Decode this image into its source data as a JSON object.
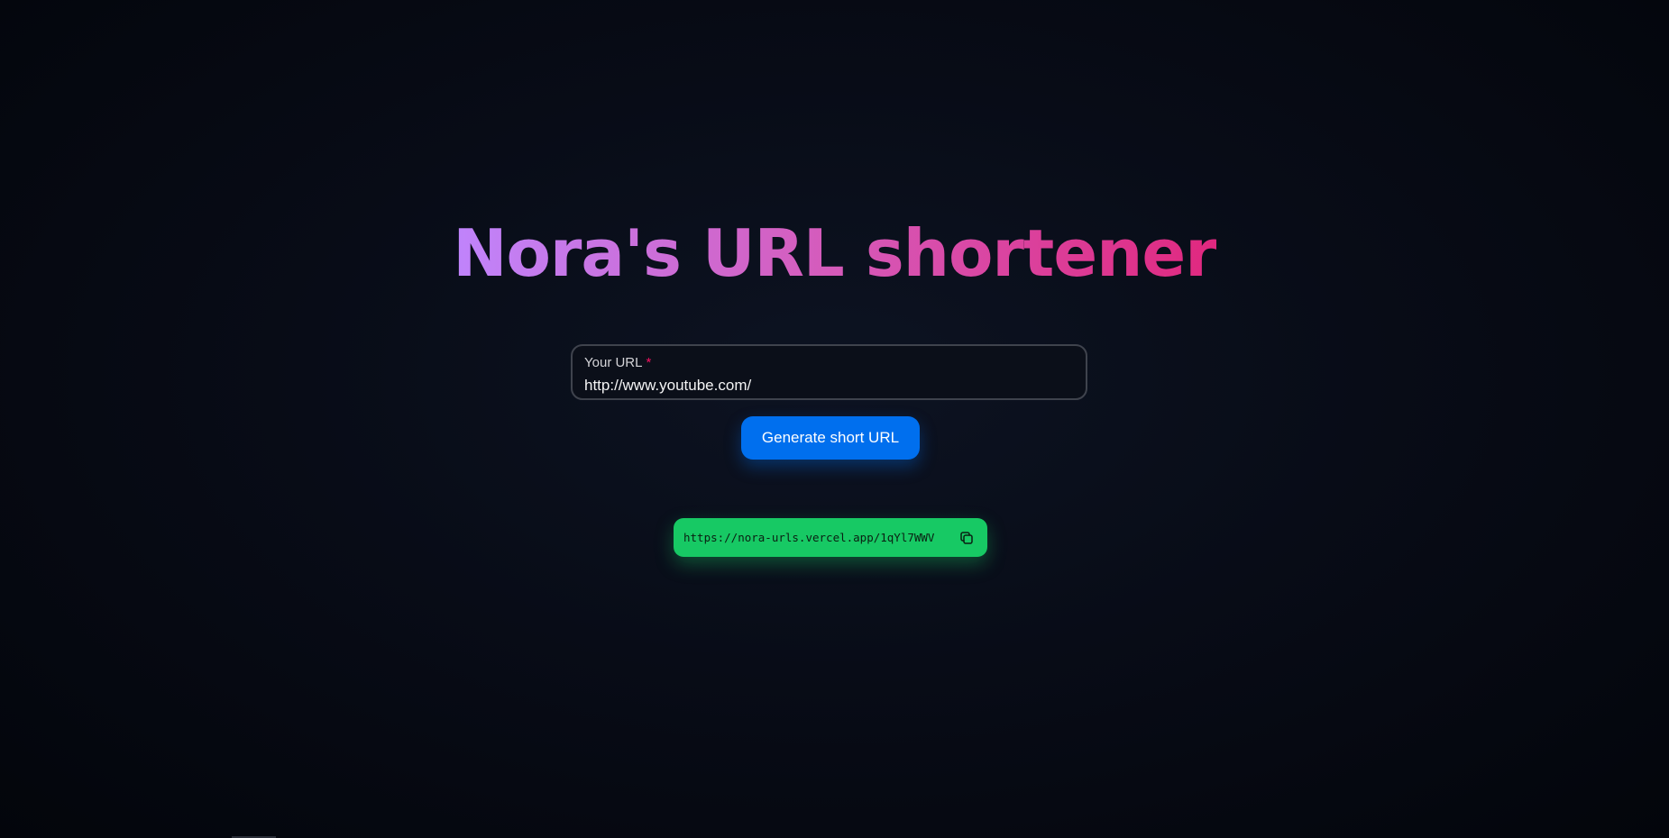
{
  "header": {
    "title": "Nora's URL shortener"
  },
  "form": {
    "url_label": "Your URL",
    "required_mark": "*",
    "url_value": "http://www.youtube.com/",
    "submit_label": "Generate short URL"
  },
  "result": {
    "short_url": "https://nora-urls.vercel.app/1qYl7WWV"
  },
  "icons": {
    "copy": "copy-icon"
  },
  "colors": {
    "title_gradient_start": "#c084fc",
    "title_gradient_end": "#e0287f",
    "primary_button": "#006fee",
    "success_chip": "#17c964",
    "required": "#f31260"
  }
}
